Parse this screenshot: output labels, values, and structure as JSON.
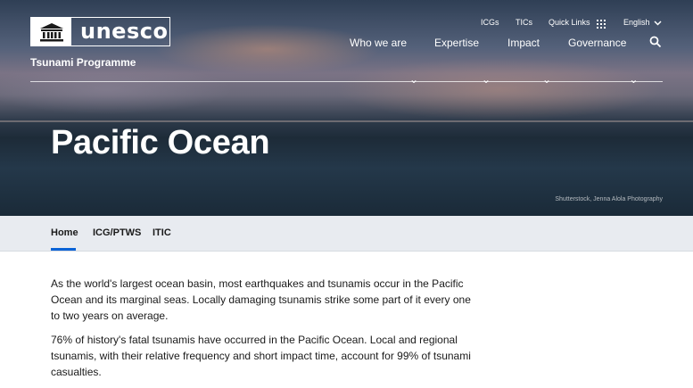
{
  "logo": {
    "wordmark": "unesco",
    "subtitle": "Tsunami Programme"
  },
  "top_links": [
    {
      "label": "ICGs"
    },
    {
      "label": "TICs"
    },
    {
      "label": "Quick Links",
      "icon": "grid-icon"
    },
    {
      "label": "English",
      "icon": "chevron-down-icon"
    }
  ],
  "main_nav": [
    {
      "label": "Who we are"
    },
    {
      "label": "Expertise"
    },
    {
      "label": "Impact"
    },
    {
      "label": "Governance"
    }
  ],
  "search": {
    "icon": "search-icon"
  },
  "hero": {
    "title": "Pacific Ocean",
    "credit": "Shutterstock, Jenna Alola Photography"
  },
  "tabs": [
    {
      "label": "Home",
      "active": true
    },
    {
      "label": "ICG/PTWS",
      "active": false
    },
    {
      "label": "ITIC",
      "active": false
    }
  ],
  "body": {
    "paragraphs": [
      "As the world's largest ocean basin, most earthquakes and tsunamis occur in the Pacific Ocean and its marginal seas. Locally damaging tsunamis strike some part of it every one to two years on average.",
      "76% of history's fatal tsunamis have occurred in the Pacific Ocean. Local and regional tsunamis, with their relative frequency and short impact time, account for 99% of tsunami casualties."
    ]
  },
  "colors": {
    "accent": "#0b63d6",
    "subnav_bg": "#e8ebf0",
    "text": "#1a1a1a"
  }
}
